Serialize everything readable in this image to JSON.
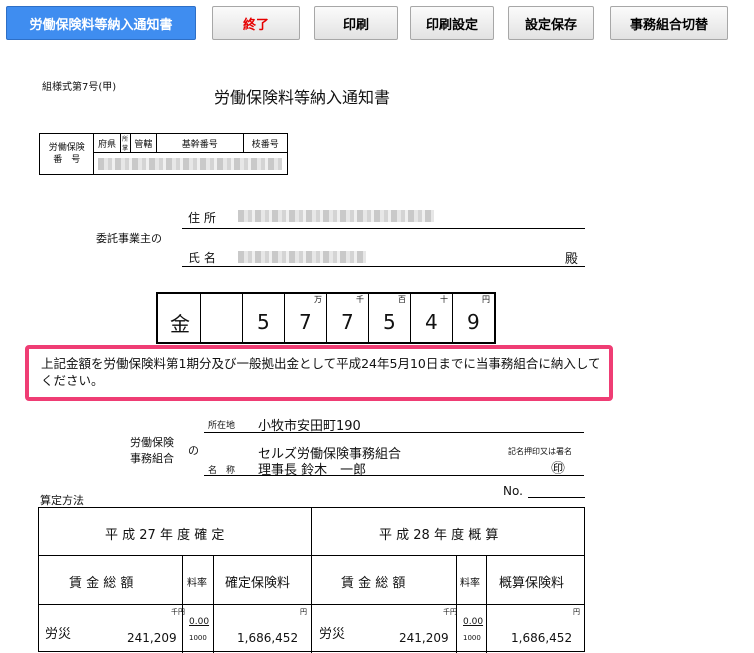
{
  "toolbar": {
    "buttons": [
      {
        "label": "労働保険料等納入通知書"
      },
      {
        "label": "終了"
      },
      {
        "label": "印刷"
      },
      {
        "label": "印刷設定"
      },
      {
        "label": "設定保存"
      },
      {
        "label": "事務組合切替"
      }
    ]
  },
  "form": {
    "form_number": "組様式第7号(甲)",
    "title": "労働保険料等納入通知書",
    "insurance_table": {
      "row_label": "労働保険\n番　号",
      "headers": [
        "府県",
        "所掌",
        "管轄",
        "基幹番号",
        "枝番号"
      ]
    },
    "consignor": {
      "group_label": "委託事業主の",
      "address_label": "住 所",
      "name_label": "氏 名",
      "honorific": "殿"
    },
    "amount": {
      "prefix": "金",
      "units": [
        "万",
        "千",
        "百",
        "十",
        "円"
      ],
      "digits": [
        "5",
        "7",
        "7",
        "5",
        "4",
        "9"
      ]
    },
    "notice_text": "上記金額を労働保険料第1期分及び一般拠出金として平成24年5月10日までに当事務組合に納入してください。",
    "union": {
      "label_line1": "労働保険",
      "label_line2": "事務組合",
      "no_particle": "の",
      "address_label": "所在地",
      "address": "小牧市安田町190",
      "name_label": "名　称",
      "name": "セルズ労働保険事務組合",
      "representative": "理事長 鈴木　一郎",
      "seal_note": "記名押印又は署名",
      "seal_mark": "㊞"
    },
    "no_label": "No.",
    "calc_title": "算定方法",
    "calc_table": {
      "left_header": "平 成 27 年 度 確 定",
      "right_header": "平 成 28 年 度 概 算",
      "col_wages": "賃 金 総 額",
      "col_rate": "料率",
      "col_confirmed": "確定保険料",
      "col_estimated": "概算保険料",
      "unit_thousand": "千円",
      "unit_yen": "円",
      "row_label": "労災",
      "left_wages": "241,209",
      "left_rate_num": "0.00",
      "left_rate_den": "1000",
      "left_premium": "1,686,452",
      "right_wages": "241,209",
      "right_rate_num": "0.00",
      "right_rate_den": "1000",
      "right_premium": "1,686,452"
    }
  },
  "colors": {
    "active_button": "#3f8df0",
    "exit_label": "#e60000",
    "callout_border": "#ef3d74"
  }
}
